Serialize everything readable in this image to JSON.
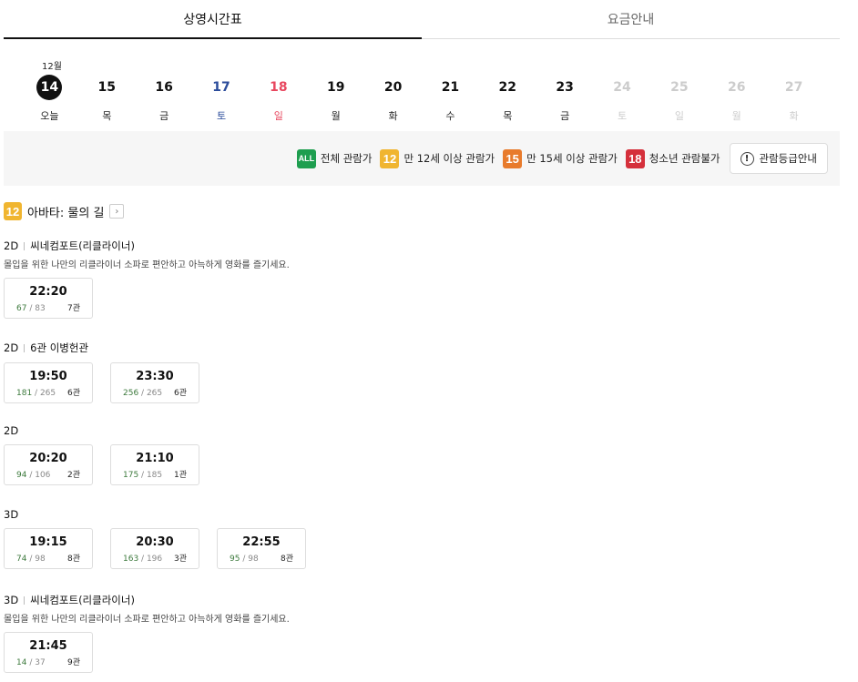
{
  "tabs": [
    {
      "label": "상영시간표",
      "active": true
    },
    {
      "label": "요금안내",
      "active": false
    }
  ],
  "month": "12월",
  "dates": [
    {
      "day": "14",
      "dow": "오늘",
      "kind": "today"
    },
    {
      "day": "15",
      "dow": "목",
      "kind": "normal"
    },
    {
      "day": "16",
      "dow": "금",
      "kind": "normal"
    },
    {
      "day": "17",
      "dow": "토",
      "kind": "sat"
    },
    {
      "day": "18",
      "dow": "일",
      "kind": "sun"
    },
    {
      "day": "19",
      "dow": "월",
      "kind": "normal"
    },
    {
      "day": "20",
      "dow": "화",
      "kind": "normal"
    },
    {
      "day": "21",
      "dow": "수",
      "kind": "normal"
    },
    {
      "day": "22",
      "dow": "목",
      "kind": "normal"
    },
    {
      "day": "23",
      "dow": "금",
      "kind": "normal"
    },
    {
      "day": "24",
      "dow": "토",
      "kind": "off"
    },
    {
      "day": "25",
      "dow": "일",
      "kind": "off"
    },
    {
      "day": "26",
      "dow": "월",
      "kind": "off"
    },
    {
      "day": "27",
      "dow": "화",
      "kind": "off"
    }
  ],
  "ratings": [
    {
      "badge": "ALL",
      "label": "전체 관람가",
      "cls": "all"
    },
    {
      "badge": "12",
      "label": "만 12세 이상 관람가",
      "cls": "r12"
    },
    {
      "badge": "15",
      "label": "만 15세 이상 관람가",
      "cls": "r15"
    },
    {
      "badge": "18",
      "label": "청소년 관람불가",
      "cls": "r18"
    }
  ],
  "rating_guide": {
    "icon": "!",
    "label": "관람등급안내"
  },
  "movie": {
    "badge": "12",
    "title": "아바타: 물의 길",
    "more": "›"
  },
  "sections": [
    {
      "format": "2D",
      "hall_name": "씨네컴포트(리클라이너)",
      "desc": "몰입을 위한 나만의 리클라이너 소파로 편안하고 아늑하게 영화를 즐기세요.",
      "slots": [
        {
          "time": "22:20",
          "avail": "67",
          "total": "83",
          "hall": "7관"
        }
      ]
    },
    {
      "format": "2D",
      "hall_name": "6관 이병헌관",
      "desc": "",
      "slots": [
        {
          "time": "19:50",
          "avail": "181",
          "total": "265",
          "hall": "6관"
        },
        {
          "time": "23:30",
          "avail": "256",
          "total": "265",
          "hall": "6관"
        }
      ]
    },
    {
      "format": "2D",
      "hall_name": "",
      "desc": "",
      "slots": [
        {
          "time": "20:20",
          "avail": "94",
          "total": "106",
          "hall": "2관"
        },
        {
          "time": "21:10",
          "avail": "175",
          "total": "185",
          "hall": "1관"
        }
      ]
    },
    {
      "format": "3D",
      "hall_name": "",
      "desc": "",
      "slots": [
        {
          "time": "19:15",
          "avail": "74",
          "total": "98",
          "hall": "8관"
        },
        {
          "time": "20:30",
          "avail": "163",
          "total": "196",
          "hall": "3관"
        },
        {
          "time": "22:55",
          "avail": "95",
          "total": "98",
          "hall": "8관"
        }
      ]
    },
    {
      "format": "3D",
      "hall_name": "씨네컴포트(리클라이너)",
      "desc": "몰입을 위한 나만의 리클라이너 소파로 편안하고 아늑하게 영화를 즐기세요.",
      "slots": [
        {
          "time": "21:45",
          "avail": "14",
          "total": "37",
          "hall": "9관"
        }
      ]
    }
  ]
}
